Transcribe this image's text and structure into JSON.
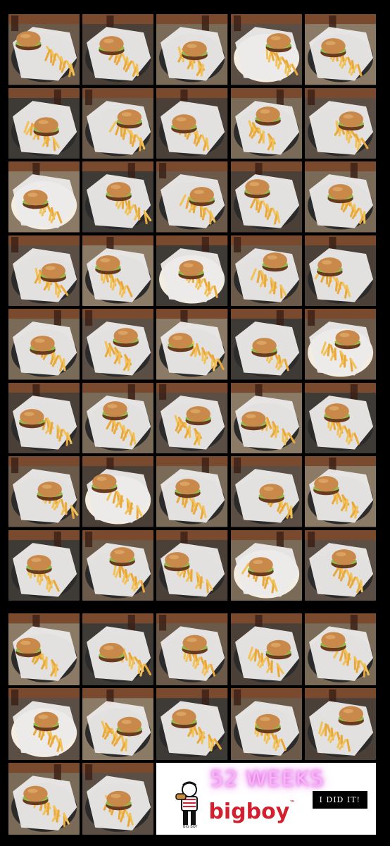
{
  "collage": {
    "photos_top": [
      "burger-fries",
      "burger-fries",
      "burger-fries",
      "burger-fries",
      "burger-fries",
      "burger-fries",
      "burger-fries",
      "burger-fries",
      "burger-fries",
      "burger-fries",
      "burger-fries",
      "burger-fries",
      "burger-fries",
      "burger-fries",
      "burger-fries",
      "burger-fries",
      "burger-fries",
      "burger-fries",
      "burger-fries",
      "burger-fries",
      "burger-fries",
      "burger-fries",
      "burger-fries",
      "burger-fries",
      "burger-fries",
      "burger-fries",
      "burger-fries",
      "burger-fries",
      "burger-fries",
      "burger-fries",
      "burger-fries",
      "burger-fries",
      "burger-fries",
      "burger-fries",
      "burger-fries",
      "burger-fries",
      "burger-fries",
      "burger-fries",
      "burger-fries",
      "burger-fries"
    ],
    "photos_bottom": [
      "burger-fries",
      "burger-fries",
      "burger-fries",
      "burger-fries",
      "burger-fries",
      "burger-fries",
      "burger-fries",
      "burger-fries",
      "burger-fries",
      "burger-fries",
      "burger-fries",
      "burger-fries"
    ]
  },
  "banner": {
    "title": "52 WEEKS",
    "badge": "I DID IT!",
    "logo_text": "bigboy",
    "logo_tm": "™",
    "mascot_icon": "big-boy-mascot-icon"
  }
}
